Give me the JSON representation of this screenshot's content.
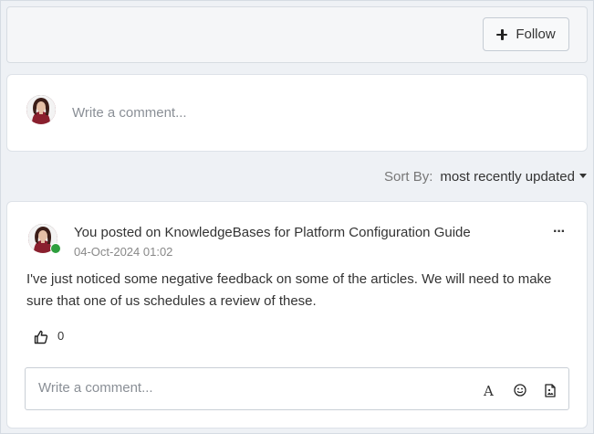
{
  "header": {
    "follow_label": "Follow"
  },
  "top_comment": {
    "placeholder": "Write a comment..."
  },
  "sort": {
    "label": "Sort By:",
    "value": "most recently updated"
  },
  "post": {
    "title": "You posted on KnowledgeBases for Platform Configuration Guide",
    "date": "04-Oct-2024 01:02",
    "body": "I've just noticed some negative feedback on some of the articles.  We will need to make sure that one of us schedules a review of these.",
    "like_count": "0",
    "author_online": true
  },
  "reply": {
    "placeholder": "Write a comment...",
    "format_label": "A"
  },
  "icons": [
    "plus-icon",
    "avatar",
    "caret-down-icon",
    "more-icon",
    "thumbs-up-icon",
    "text-format-icon",
    "emoji-icon",
    "attachment-icon"
  ],
  "colors": {
    "online": "#2e9e3e",
    "background": "#eef1f5",
    "placeholder": "#8a8f96"
  }
}
